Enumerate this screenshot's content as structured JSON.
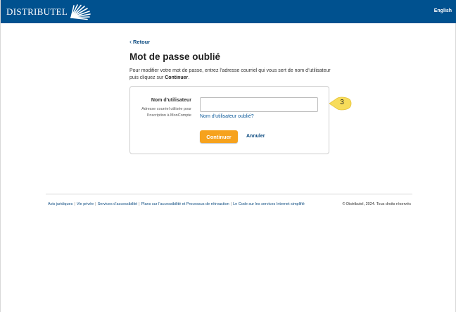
{
  "header": {
    "logo_text": "DISTRIBUTEL",
    "language_link": "English",
    "brand_color": "#00518f"
  },
  "nav": {
    "back_label": "Retour"
  },
  "page": {
    "title": "Mot de passe oublié",
    "intro_text": "Pour modifier votre mot de passe, entrez l’adresse courriel qui vous sert de nom d’utilisateur puis cliquez sur ",
    "intro_emphasis": "Continuer",
    "intro_end": "."
  },
  "form": {
    "username_label": "Nom d’utilisateur",
    "username_hint_line1": "Adresse courriel utilisée pour",
    "username_hint_line2": "l’inscription à MonCompte",
    "username_value": "",
    "forgot_username_link": "Nom d’utilisateur oublié?",
    "continue_button": "Continuer",
    "cancel_link": "Annuler",
    "accent_color": "#f6a21d"
  },
  "callout": {
    "step_number": "3",
    "color": "#f7dc5a"
  },
  "footer": {
    "links": [
      "Avis juridiques",
      "Vie privée",
      "Services d’accessibilité",
      "Plans sur l’accessibilité et Processus de rétroaction",
      "Le Code sur les services Internet simplifié"
    ],
    "copyright": "© Distributel, 2024. Tous droits réservés"
  }
}
